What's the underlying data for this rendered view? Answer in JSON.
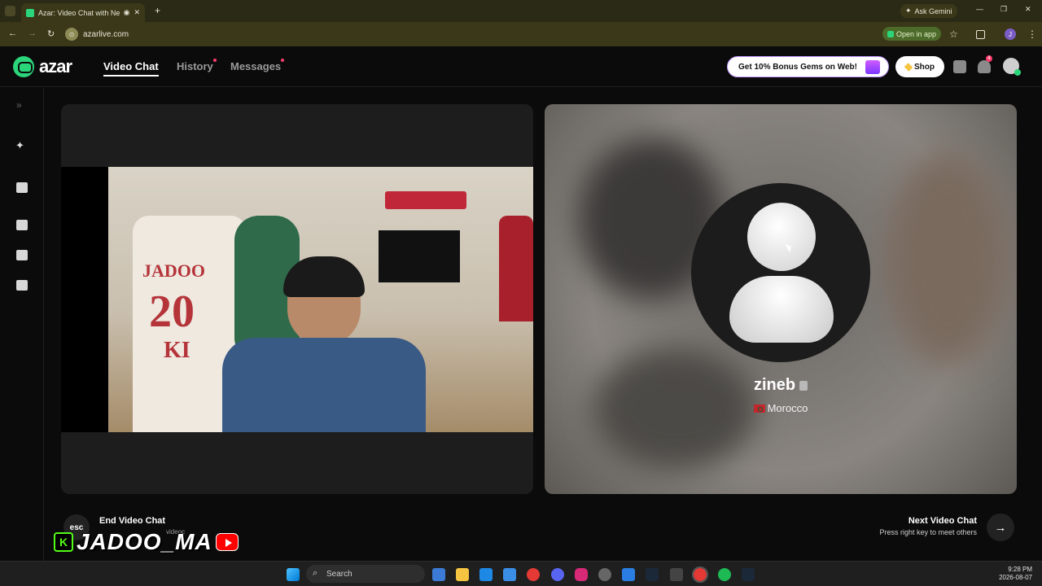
{
  "browser": {
    "tab_title": "Azar: Video Chat with New",
    "url": "azarlive.com",
    "ask_gemini": "Ask Gemini",
    "open_in_app": "Open in app",
    "profile_initial": "J"
  },
  "app": {
    "logo_text": "azar",
    "nav": {
      "video_chat": "Video Chat",
      "history": "History",
      "messages": "Messages"
    },
    "promo": "Get 10% Bonus Gems on Web!",
    "shop": "Shop",
    "notification_count": "4"
  },
  "remote": {
    "name": "zineb",
    "country": "Morocco"
  },
  "local_video": {
    "jersey_name": "JADOO",
    "jersey_number": "20",
    "jersey_letters": "KI"
  },
  "controls": {
    "esc_key": "esc",
    "end_label": "End Video Chat",
    "end_sub": "videoc",
    "next_label": "Next Video Chat",
    "next_sub": "Press right key to meet others",
    "next_arrow": "→"
  },
  "overlay": {
    "badge": "K",
    "handle": "JADOO_MA"
  },
  "taskbar": {
    "search_placeholder": "Search",
    "time": "9:28 PM",
    "date": "2026-08-07"
  },
  "colors": {
    "accent": "#2bd67b",
    "notify": "#ff3d6e"
  }
}
